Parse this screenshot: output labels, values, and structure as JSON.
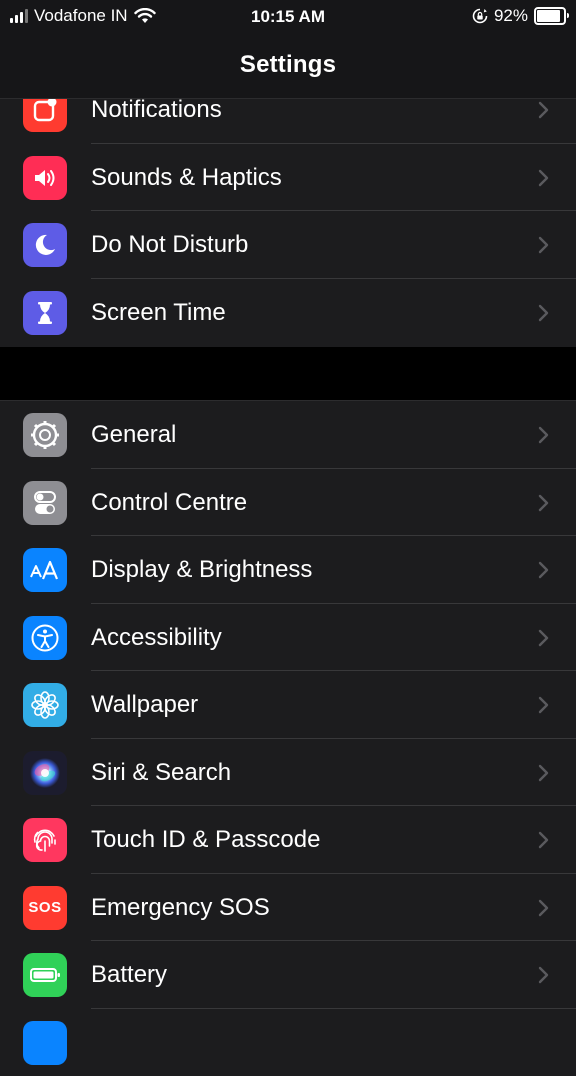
{
  "status_bar": {
    "carrier": "Vodafone IN",
    "time": "10:15 AM",
    "battery_percent": "92%",
    "battery_level": 0.92,
    "signal_bars": 3,
    "icons": [
      "signal-icon",
      "wifi-icon",
      "orientation-lock-icon",
      "battery-icon"
    ]
  },
  "nav": {
    "title": "Settings"
  },
  "group1": [
    {
      "label": "Notifications",
      "icon": "notifications-icon",
      "color": "#ff3b30"
    },
    {
      "label": "Sounds & Haptics",
      "icon": "speaker-icon",
      "color": "#ff2d55"
    },
    {
      "label": "Do Not Disturb",
      "icon": "moon-icon",
      "color": "#5e5ce6"
    },
    {
      "label": "Screen Time",
      "icon": "hourglass-icon",
      "color": "#5e5ce6"
    }
  ],
  "group2": [
    {
      "label": "General",
      "icon": "gear-icon",
      "color": "#8e8e93"
    },
    {
      "label": "Control Centre",
      "icon": "toggles-icon",
      "color": "#8e8e93"
    },
    {
      "label": "Display & Brightness",
      "icon": "text-size-icon",
      "color": "#0a84ff"
    },
    {
      "label": "Accessibility",
      "icon": "accessibility-icon",
      "color": "#0a84ff"
    },
    {
      "label": "Wallpaper",
      "icon": "flower-icon",
      "color": "#32ade6"
    },
    {
      "label": "Siri & Search",
      "icon": "siri-icon",
      "color": "#1c1c2e"
    },
    {
      "label": "Touch ID & Passcode",
      "icon": "fingerprint-icon",
      "color": "#ff375f"
    },
    {
      "label": "Emergency SOS",
      "icon": "sos-icon",
      "color": "#ff3b30",
      "icon_text": "SOS"
    },
    {
      "label": "Battery",
      "icon": "battery-row-icon",
      "color": "#30d158"
    },
    {
      "label": "",
      "icon": "partial-icon",
      "color": "#0a84ff"
    }
  ]
}
